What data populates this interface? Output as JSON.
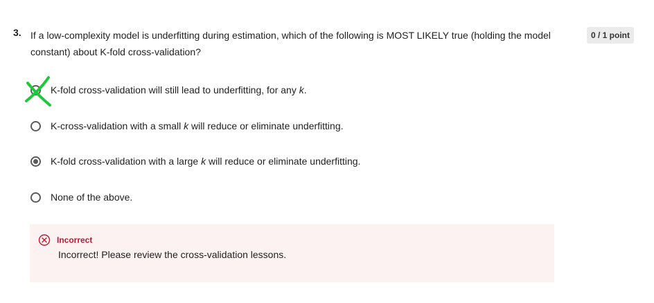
{
  "question": {
    "number": "3.",
    "text": "If a low-complexity model is underfitting during estimation, which of the following is MOST LIKELY true (holding the model constant) about K-fold cross-validation?",
    "points": "0 / 1 point"
  },
  "options": [
    {
      "before": "K-fold cross-validation will still lead to underfitting, for any ",
      "var": "k",
      "after": ".",
      "selected": false,
      "marked": "cross-mark-icon"
    },
    {
      "before": "K-cross-validation with a small ",
      "var": "k",
      "after": " will reduce or eliminate underfitting.",
      "selected": false
    },
    {
      "before": "K-fold cross-validation with a large ",
      "var": "k",
      "after": " will reduce or eliminate underfitting.",
      "selected": true
    },
    {
      "before": "None of the above.",
      "var": "",
      "after": "",
      "selected": false
    }
  ],
  "feedback": {
    "title": "Incorrect",
    "message": "Incorrect! Please review the cross-validation lessons.",
    "icon": "x-circle-icon"
  },
  "colors": {
    "error": "#c0162e",
    "feedback_bg": "#fdf2f2",
    "annotation_mark": "#1ec83c",
    "badge_bg": "#ebebeb"
  }
}
